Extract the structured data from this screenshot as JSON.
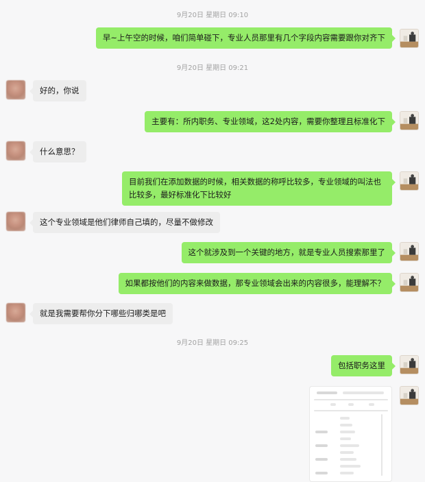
{
  "timestamps": [
    "9月20日 星期日 09:10",
    "9月20日 星期日 09:21",
    "9月20日 星期日 09:25"
  ],
  "messages": [
    {
      "from": "self",
      "text": "早~上午空的时候，咱们简单碰下，专业人员那里有几个字段内容需要跟你对齐下"
    },
    {
      "from": "peer",
      "text": "好的，你说"
    },
    {
      "from": "self",
      "text": "主要有：所内职务、专业领域，这2处内容，需要你整理且标准化下"
    },
    {
      "from": "peer",
      "text": "什么意思？"
    },
    {
      "from": "self",
      "text": "目前我们在添加数据的时候，相关数据的称呼比较多，专业领域的叫法也比较多，最好标准化下比较好"
    },
    {
      "from": "peer",
      "text": "这个专业领域是他们律师自己填的，尽量不做修改"
    },
    {
      "from": "self",
      "text": "这个就涉及到一个关键的地方，就是专业人员搜索那里了"
    },
    {
      "from": "self",
      "text": "如果都按他们的内容来做数据，那专业领域会出来的内容很多，能理解不？"
    },
    {
      "from": "peer",
      "text": "就是我需要帮你分下哪些归哪类是吧"
    },
    {
      "from": "self",
      "text": "包括职务这里"
    },
    {
      "from": "self",
      "type": "image",
      "icon": "blurred-screenshot-thumbnail"
    }
  ],
  "colors": {
    "self_bubble": "#95ec69",
    "peer_bubble": "#ededed",
    "background": "#f7f7f8",
    "timestamp": "#a2a2a2"
  }
}
